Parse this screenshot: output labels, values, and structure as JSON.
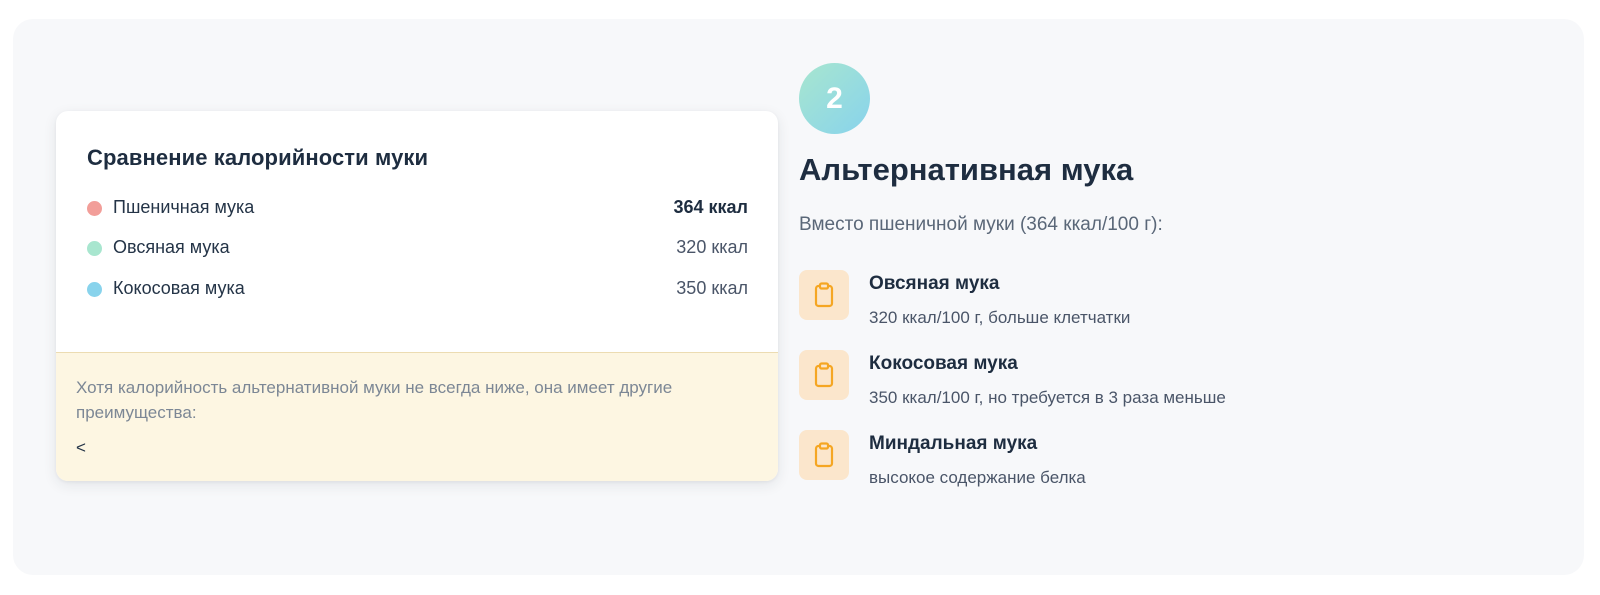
{
  "comparison_card": {
    "title": "Сравнение калорийности муки",
    "rows": [
      {
        "name": "Пшеничная мука",
        "kcal": "364 ккал",
        "color": "#f29e99"
      },
      {
        "name": "Овсяная мука",
        "kcal": "320 ккал",
        "color": "#a8e6cf"
      },
      {
        "name": "Кокосовая мука",
        "kcal": "350 ккал",
        "color": "#88d3ec"
      }
    ],
    "note": "Хотя калорийность альтернативной муки не всегда ниже, она имеет другие преимущества:",
    "note_glyph": "<"
  },
  "step": {
    "number": "2",
    "title": "Альтернативная мука",
    "subtitle": "Вместо пшеничной муки (364 ккал/100 г):",
    "icon": "clipboard-icon",
    "accent_color": "#f5a623",
    "items": [
      {
        "name": "Овсяная мука",
        "desc": "320 ккал/100 г, больше клетчатки"
      },
      {
        "name": "Кокосовая мука",
        "desc": "350 ккал/100 г, но требуется в 3 раза меньше"
      },
      {
        "name": "Миндальная мука",
        "desc": "высокое содержание белка"
      }
    ]
  }
}
